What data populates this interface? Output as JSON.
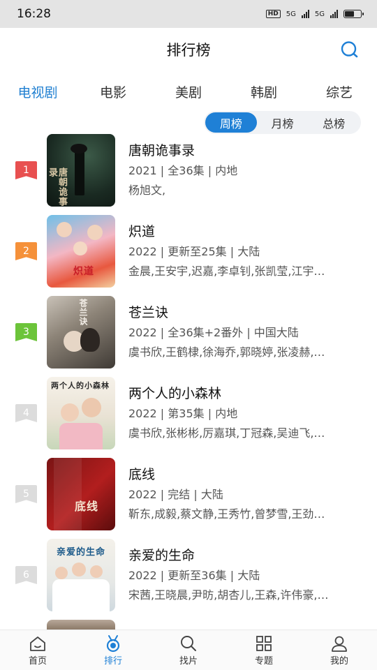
{
  "status_bar": {
    "time": "16:28",
    "network": "5G",
    "hd_label": "HD"
  },
  "header": {
    "title": "排行榜"
  },
  "category_tabs": [
    {
      "label": "电视剧",
      "active": true
    },
    {
      "label": "电影",
      "active": false
    },
    {
      "label": "美剧",
      "active": false
    },
    {
      "label": "韩剧",
      "active": false
    },
    {
      "label": "综艺",
      "active": false
    }
  ],
  "period_tabs": [
    {
      "label": "周榜",
      "active": true
    },
    {
      "label": "月榜",
      "active": false
    },
    {
      "label": "总榜",
      "active": false
    }
  ],
  "ranking": [
    {
      "rank": "1",
      "title": "唐朝诡事录",
      "meta": "2021 | 全36集 | 内地",
      "cast": "杨旭文,",
      "badge_color": "#e85050",
      "poster_text": "唐朝诡事录"
    },
    {
      "rank": "2",
      "title": "炽道",
      "meta": "2022 | 更新至25集 | 大陆",
      "cast": "金晨,王安宇,迟嘉,李卓钊,张凯莹,江宇…",
      "badge_color": "#f5913a",
      "poster_text": "炽道"
    },
    {
      "rank": "3",
      "title": "苍兰诀",
      "meta": "2022 | 全36集+2番外 | 中国大陆",
      "cast": "虞书欣,王鹤棣,徐海乔,郭晓婷,张凌赫,…",
      "badge_color": "#6cc43a",
      "poster_text": "苍兰诀"
    },
    {
      "rank": "4",
      "title": "两个人的小森林",
      "meta": "2022 | 第35集 | 内地",
      "cast": "虞书欣,张彬彬,厉嘉琪,丁冠森,吴迪飞,…",
      "badge_color": "#dcdcdc",
      "poster_text": "两个人的小森林"
    },
    {
      "rank": "5",
      "title": "底线",
      "meta": "2022 | 完结 | 大陆",
      "cast": "靳东,成毅,蔡文静,王秀竹,曾梦雪,王劲…",
      "badge_color": "#dcdcdc",
      "poster_text": "底线"
    },
    {
      "rank": "6",
      "title": "亲爱的生命",
      "meta": "2022 | 更新至36集 | 大陆",
      "cast": "宋茜,王晓晨,尹昉,胡杏儿,王森,许伟豪,…",
      "badge_color": "#dcdcdc",
      "poster_text": "亲爱的生命"
    }
  ],
  "bottom_nav": [
    {
      "label": "首页",
      "icon": "home-icon",
      "active": false
    },
    {
      "label": "排行",
      "icon": "medal-icon",
      "active": true
    },
    {
      "label": "找片",
      "icon": "search-icon",
      "active": false
    },
    {
      "label": "专题",
      "icon": "grid-icon",
      "active": false
    },
    {
      "label": "我的",
      "icon": "user-icon",
      "active": false
    }
  ],
  "colors": {
    "accent": "#1f80d6",
    "tab_active": "#1f7fd1"
  }
}
